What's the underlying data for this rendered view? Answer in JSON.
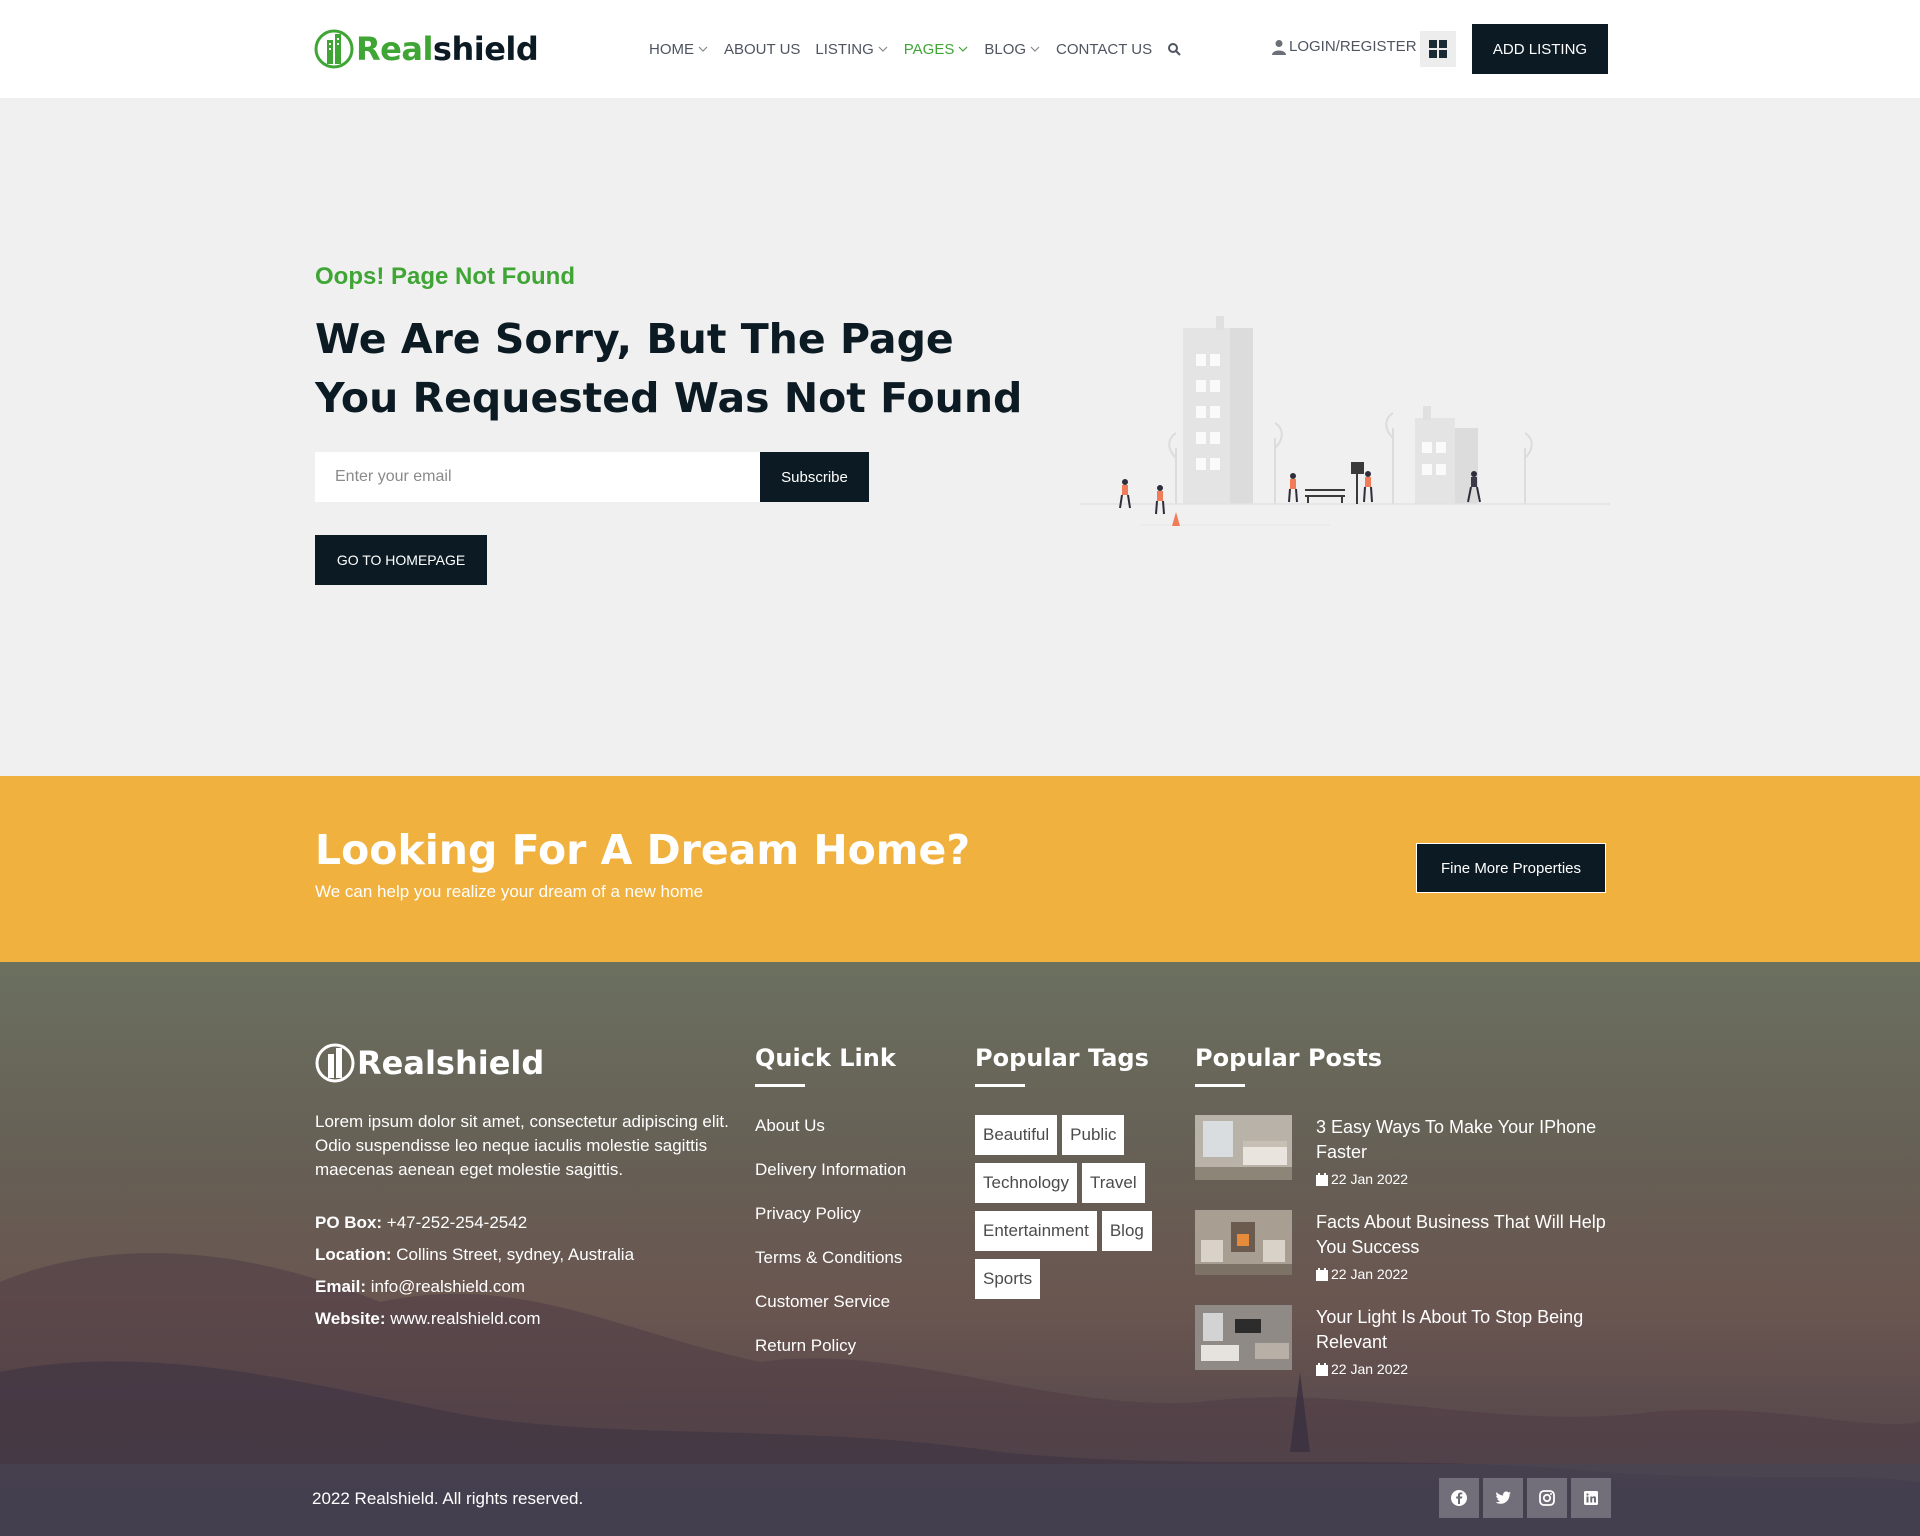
{
  "brand": {
    "part1": "Real",
    "part2": "shield",
    "footer_name": "Realshield"
  },
  "nav": {
    "items": [
      {
        "label": "HOME",
        "dropdown": true
      },
      {
        "label": "ABOUT US",
        "dropdown": false
      },
      {
        "label": "LISTING",
        "dropdown": true
      },
      {
        "label": "PAGES",
        "dropdown": true,
        "active": true
      },
      {
        "label": "BLOG",
        "dropdown": true
      },
      {
        "label": "CONTACT US",
        "dropdown": false
      }
    ],
    "search_icon": "search-icon",
    "login_label": "LOGIN/REGISTER",
    "grid_icon": "grid-icon",
    "add_listing_label": "ADD LISTING"
  },
  "hero": {
    "subtitle": "Oops! Page Not Found",
    "title": "We Are Sorry, But The Page You Requested Was Not Found",
    "email_placeholder": "Enter your email",
    "subscribe_label": "Subscribe",
    "home_button_label": "GO TO HOMEPAGE"
  },
  "cta": {
    "title": "Looking For A Dream Home?",
    "subtitle": "We can help you realize your dream of a new home",
    "button_label": "Fine More Properties"
  },
  "footer": {
    "about": "Lorem ipsum dolor sit amet, consectetur adipiscing elit. Odio suspendisse leo neque iaculis molestie sagittis maecenas aenean eget molestie sagittis.",
    "contact": {
      "po_box_label": "PO Box:",
      "po_box": "+47-252-254-2542",
      "location_label": "Location:",
      "location": "Collins Street, sydney, Australia",
      "email_label": "Email:",
      "email": "info@realshield.com",
      "website_label": "Website:",
      "website": "www.realshield.com"
    },
    "quick_link": {
      "title": "Quick Link",
      "items": [
        "About Us",
        "Delivery Information",
        "Privacy Policy",
        "Terms & Conditions",
        "Customer Service",
        "Return Policy"
      ]
    },
    "tags": {
      "title": "Popular Tags",
      "items": [
        "Beautiful",
        "Public",
        "Technology",
        "Travel",
        "Entertainment",
        "Blog",
        "Sports"
      ]
    },
    "posts": {
      "title": "Popular Posts",
      "items": [
        {
          "title": "3 Easy Ways To Make Your IPhone Faster",
          "date": "22 Jan 2022"
        },
        {
          "title": "Facts About Business That Will Help You Success",
          "date": "22 Jan 2022"
        },
        {
          "title": "Your Light Is About To Stop Being Relevant",
          "date": "22 Jan 2022"
        }
      ]
    },
    "copyright": "2022 Realshield. All rights reserved.",
    "socials": [
      "facebook-icon",
      "twitter-icon",
      "instagram-icon",
      "linkedin-icon"
    ]
  },
  "colors": {
    "accent": "#3fa535",
    "dark": "#0c1b23",
    "cta_bg": "#f0b13f"
  }
}
